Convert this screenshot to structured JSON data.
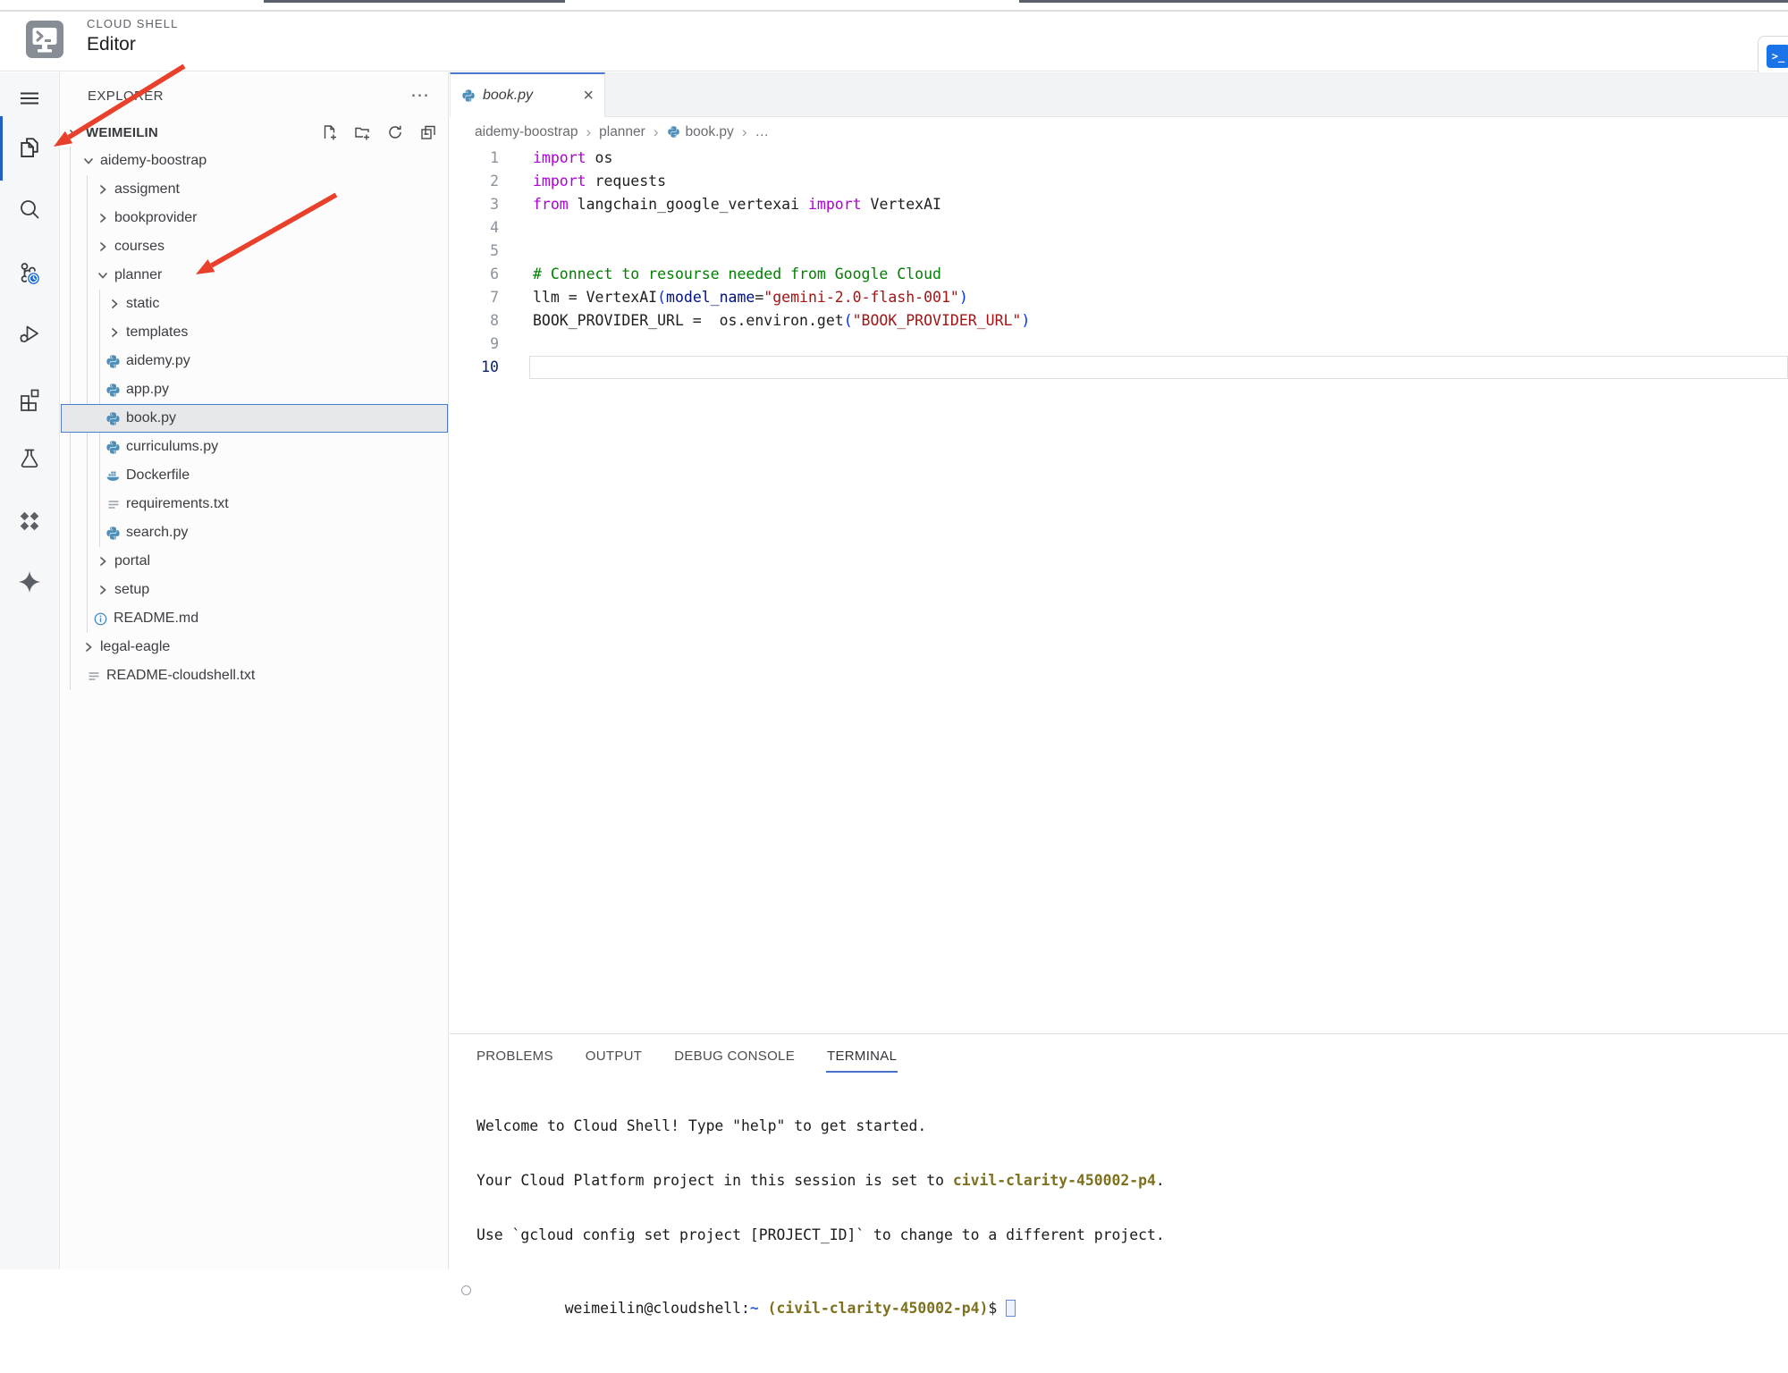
{
  "header": {
    "product_label": "CLOUD SHELL",
    "product_title": "Editor"
  },
  "open_terminal_button": {
    "glyph": ">_"
  },
  "activity_bar": {
    "items": [
      {
        "name": "menu"
      },
      {
        "name": "explorer",
        "active": true
      },
      {
        "name": "search"
      },
      {
        "name": "source-control",
        "badge": "pending-clock"
      },
      {
        "name": "run-debug"
      },
      {
        "name": "extensions"
      },
      {
        "name": "test-beaker"
      },
      {
        "name": "cloud-code"
      },
      {
        "name": "gemini-sparkle"
      }
    ]
  },
  "explorer": {
    "title": "EXPLORER",
    "more_actions_glyph": "⋯",
    "workspace_actions": [
      "new-file",
      "new-folder",
      "refresh-explorer",
      "collapse-folders"
    ],
    "tree": [
      {
        "label": "WEIMEILIN",
        "type": "workspace-root",
        "level": 0,
        "expanded": true
      },
      {
        "label": "aidemy-boostrap",
        "type": "folder",
        "level": 1,
        "expanded": true
      },
      {
        "label": "assigment",
        "type": "folder",
        "level": 2,
        "expanded": false
      },
      {
        "label": "bookprovider",
        "type": "folder",
        "level": 2,
        "expanded": false
      },
      {
        "label": "courses",
        "type": "folder",
        "level": 2,
        "expanded": false
      },
      {
        "label": "planner",
        "type": "folder",
        "level": 2,
        "expanded": true
      },
      {
        "label": "static",
        "type": "folder",
        "level": 3,
        "expanded": false
      },
      {
        "label": "templates",
        "type": "folder",
        "level": 3,
        "expanded": false
      },
      {
        "label": "aidemy.py",
        "type": "file",
        "icon": "python",
        "level": 3
      },
      {
        "label": "app.py",
        "type": "file",
        "icon": "python",
        "level": 3
      },
      {
        "label": "book.py",
        "type": "file",
        "icon": "python",
        "level": 3,
        "selected": true
      },
      {
        "label": "curriculums.py",
        "type": "file",
        "icon": "python",
        "level": 3
      },
      {
        "label": "Dockerfile",
        "type": "file",
        "icon": "docker",
        "level": 3
      },
      {
        "label": "requirements.txt",
        "type": "file",
        "icon": "text",
        "level": 3
      },
      {
        "label": "search.py",
        "type": "file",
        "icon": "python",
        "level": 3
      },
      {
        "label": "portal",
        "type": "folder",
        "level": 2,
        "expanded": false
      },
      {
        "label": "setup",
        "type": "folder",
        "level": 2,
        "expanded": false
      },
      {
        "label": "README.md",
        "type": "file",
        "icon": "info",
        "level": 2
      },
      {
        "label": "legal-eagle",
        "type": "folder",
        "level": 1,
        "expanded": false
      },
      {
        "label": "README-cloudshell.txt",
        "type": "file",
        "icon": "text",
        "level": 1
      }
    ]
  },
  "editor": {
    "tabs": [
      {
        "label": "book.py",
        "close_glyph": "×",
        "preview": true,
        "active": true
      }
    ],
    "breadcrumb": {
      "separator": "›",
      "items": [
        "aidemy-boostrap",
        "planner",
        "book.py",
        "…"
      ]
    },
    "active_line": "10",
    "code": {
      "lines": [
        {
          "num": "1",
          "tokens": [
            {
              "t": "import"
            },
            {
              "t": " os"
            }
          ]
        },
        {
          "num": "2",
          "tokens": [
            {
              "t": "import"
            },
            {
              "t": " requests"
            }
          ]
        },
        {
          "num": "3",
          "tokens": [
            {
              "t": "from"
            },
            {
              "t": " langchain_google_vertexai "
            },
            {
              "t": "import"
            },
            {
              "t": " VertexAI"
            }
          ]
        },
        {
          "num": "4",
          "tokens": []
        },
        {
          "num": "5",
          "tokens": []
        },
        {
          "num": "6",
          "tokens": [
            {
              "t": "# Connect to resourse needed from Google Cloud"
            }
          ]
        },
        {
          "num": "7",
          "tokens": [
            {
              "t": "llm = VertexAI"
            },
            {
              "t": "("
            },
            {
              "t": "model_name"
            },
            {
              "t": "="
            },
            {
              "t": "\"gemini-2.0-flash-001\""
            },
            {
              "t": ")"
            }
          ]
        },
        {
          "num": "8",
          "tokens": [
            {
              "t": "BOOK_PROVIDER_URL =  os.environ.get"
            },
            {
              "t": "("
            },
            {
              "t": "\"BOOK_PROVIDER_URL\""
            },
            {
              "t": ")"
            }
          ]
        },
        {
          "num": "9",
          "tokens": []
        },
        {
          "num": "10",
          "tokens": []
        }
      ]
    }
  },
  "panel": {
    "tabs": [
      "PROBLEMS",
      "OUTPUT",
      "DEBUG CONSOLE",
      "TERMINAL"
    ],
    "active_tab": "TERMINAL",
    "terminal": {
      "lines": [
        {
          "segments": [
            {
              "style": "plain",
              "text": "Welcome to Cloud Shell! Type \"help\" to get started."
            }
          ]
        },
        {
          "segments": [
            {
              "style": "plain",
              "text": "Your Cloud Platform project in this session is set to "
            },
            {
              "style": "project",
              "text": "civil-clarity-450002-p4"
            },
            {
              "style": "plain",
              "text": "."
            }
          ]
        },
        {
          "segments": [
            {
              "style": "plain",
              "text": "Use `gcloud config set project [PROJECT_ID]` to change to a different project."
            }
          ]
        }
      ],
      "prompt": {
        "user_host": "weimeilin@cloudshell:",
        "path": "~",
        "separator": " ",
        "project": "(civil-clarity-450002-p4)",
        "suffix": "$ "
      }
    }
  },
  "annotations": {
    "arrow_color": "#E8402B",
    "arrows": [
      {
        "target": "explorer-activity-icon"
      },
      {
        "target": "planner-folder"
      }
    ]
  },
  "colors": {
    "accent_blue": "#1a73e8",
    "tab_active_border": "#4b79cc",
    "selection_border": "#4d7dcb",
    "terminal_project": "#7d7120",
    "terminal_path_blue": "#3465d9",
    "keyword_purple": "#af00db",
    "comment_green": "#008000",
    "string_red": "#a31515",
    "annotation_red": "#E8402B"
  }
}
